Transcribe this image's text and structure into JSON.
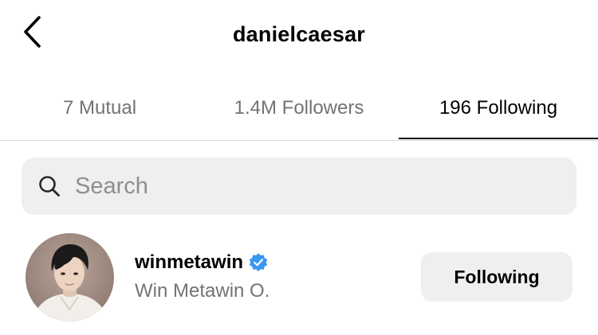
{
  "header": {
    "back_icon": "chevron-left-icon",
    "title": "danielcaesar"
  },
  "tabs": [
    {
      "label": "7 Mutual",
      "active": false
    },
    {
      "label": "1.4M Followers",
      "active": false
    },
    {
      "label": "196 Following",
      "active": true
    }
  ],
  "search": {
    "icon": "search-icon",
    "placeholder": "Search",
    "value": ""
  },
  "users": [
    {
      "username": "winmetawin",
      "verified": true,
      "full_name": "Win Metawin O.",
      "button_label": "Following"
    }
  ],
  "colors": {
    "accent_verified": "#3897f0",
    "secondary_text": "#737373",
    "button_bg": "#efefef",
    "search_bg": "#efefef"
  }
}
